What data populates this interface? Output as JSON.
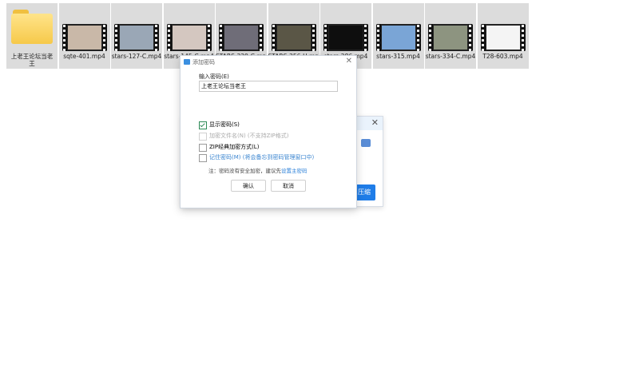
{
  "files": [
    {
      "name": "上老王论坛当老王",
      "type": "folder"
    },
    {
      "name": "sqte-401.mp4",
      "type": "video",
      "thumb": "#c9b8a8"
    },
    {
      "name": "stars-127-C.mp4",
      "type": "video",
      "thumb": "#9aa7b6"
    },
    {
      "name": "stars-145-C.mp4",
      "type": "video",
      "thumb": "#d4c7c0"
    },
    {
      "name": "STARS-229-C.mp4",
      "type": "video",
      "thumb": "#6f6d78"
    },
    {
      "name": "STARS-256-U.mp4",
      "type": "video",
      "thumb": "#5a5646"
    },
    {
      "name": "stars-286.mp4",
      "type": "video",
      "thumb": "#0e0e0e"
    },
    {
      "name": "stars-315.mp4",
      "type": "video",
      "thumb": "#7aa5d6"
    },
    {
      "name": "stars-334-C.mp4",
      "type": "video",
      "thumb": "#8d9480"
    },
    {
      "name": "T28-603.mp4",
      "type": "video",
      "thumb": "#f4f4f4"
    }
  ],
  "dialog": {
    "title": "添加密码",
    "password_label": "输入密码(E)",
    "password_value": "上老王论坛当老王",
    "show_password": "显示密码(S)",
    "encrypt_filenames": "加密文件名(N) (不支持ZIP格式)",
    "zip_legacy": "ZIP经典加密方式(L)",
    "remember_password": "记住密码(M) (将会备忘到密码管理窗口中)",
    "note_prefix": "注：密码没有安全加密，建议先",
    "note_link": "设置主密码",
    "ok": "确认",
    "cancel": "取消"
  },
  "back_dialog": {
    "close": "✕",
    "action": "压缩"
  }
}
